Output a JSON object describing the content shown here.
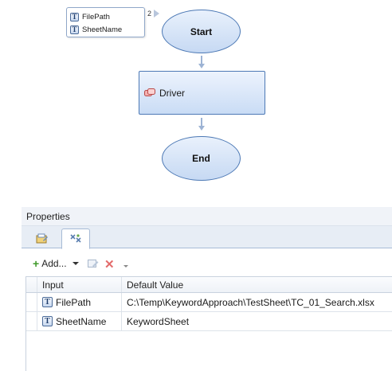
{
  "flow": {
    "parameters": [
      {
        "icon": "text-type-icon",
        "glyph": "T",
        "name": "FilePath"
      },
      {
        "icon": "text-type-icon",
        "glyph": "T",
        "name": "SheetName"
      }
    ],
    "parameter_count": "2",
    "start_label": "Start",
    "driver_label": "Driver",
    "end_label": "End"
  },
  "properties": {
    "title": "Properties",
    "tabs": [
      {
        "icon": "general-properties-icon"
      },
      {
        "icon": "parameters-icon"
      }
    ],
    "toolbar": {
      "add_label": "Add...",
      "edit_icon": "edit-icon",
      "delete_icon": "delete-icon"
    },
    "columns": [
      "Input",
      "Default Value"
    ],
    "rows": [
      {
        "glyph": "T",
        "input": "FilePath",
        "default_value": "C:\\Temp\\KeywordApproach\\TestSheet\\TC_01_Search.xlsx"
      },
      {
        "glyph": "T",
        "input": "SheetName",
        "default_value": "KeywordSheet"
      }
    ]
  },
  "colors": {
    "node_fill": "#c6d9f3",
    "node_border": "#4d79b5",
    "connector": "#9db3d4",
    "add_green": "#3f9a2a",
    "delete_red": "#e36b6b"
  }
}
